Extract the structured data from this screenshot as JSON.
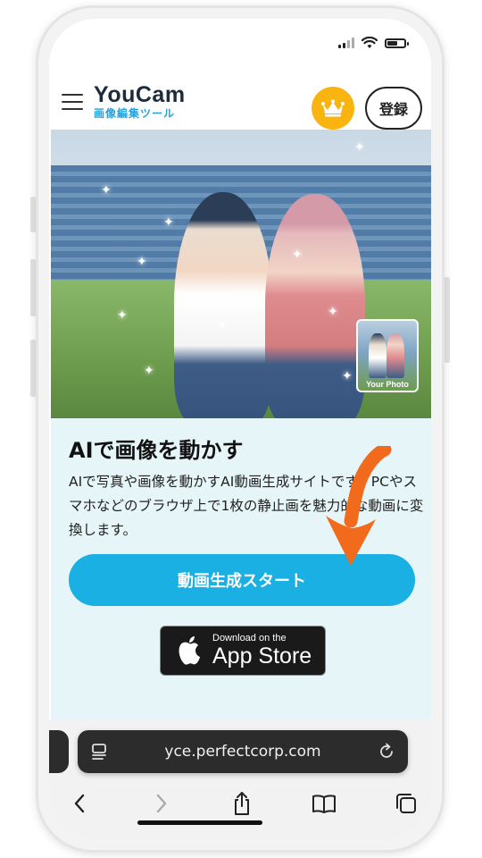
{
  "status_bar": {
    "icons": [
      "signal-icon",
      "wifi-icon",
      "battery-icon"
    ],
    "signal_bars": 2,
    "battery_level": 0.6
  },
  "header": {
    "menu_icon": "hamburger-icon",
    "logo_main": "YouCam",
    "logo_sub": "画像編集ツール",
    "premium_icon": "crown-icon",
    "register_label": "登録"
  },
  "hero": {
    "thumbnail_label": "Your Photo",
    "sparkle_glyph": "✦"
  },
  "content": {
    "title": "AIで画像を動かす",
    "description": "AIで写真や画像を動かすAI動画生成サイトです。PCやスマホなどのブラウザ上で1枚の静止画を魅力的な動画に変換します。",
    "cta_label": "動画生成スタート",
    "appstore_small": "Download on the",
    "appstore_big": "App Store",
    "annotation_arrow_icon": "orange-arrow-icon"
  },
  "browser": {
    "url": "yce.perfectcorp.com",
    "url_left_icon": "reader-mode-icon",
    "url_right_icon": "reload-icon",
    "nav_icons": [
      "back-icon",
      "forward-icon",
      "share-icon",
      "bookmarks-icon",
      "tabs-icon"
    ]
  },
  "colors": {
    "accent_blue": "#1bb0e4",
    "crown_yellow": "#f9b410",
    "content_bg": "#e6f5f7",
    "arrow_orange": "#f26a1b"
  }
}
